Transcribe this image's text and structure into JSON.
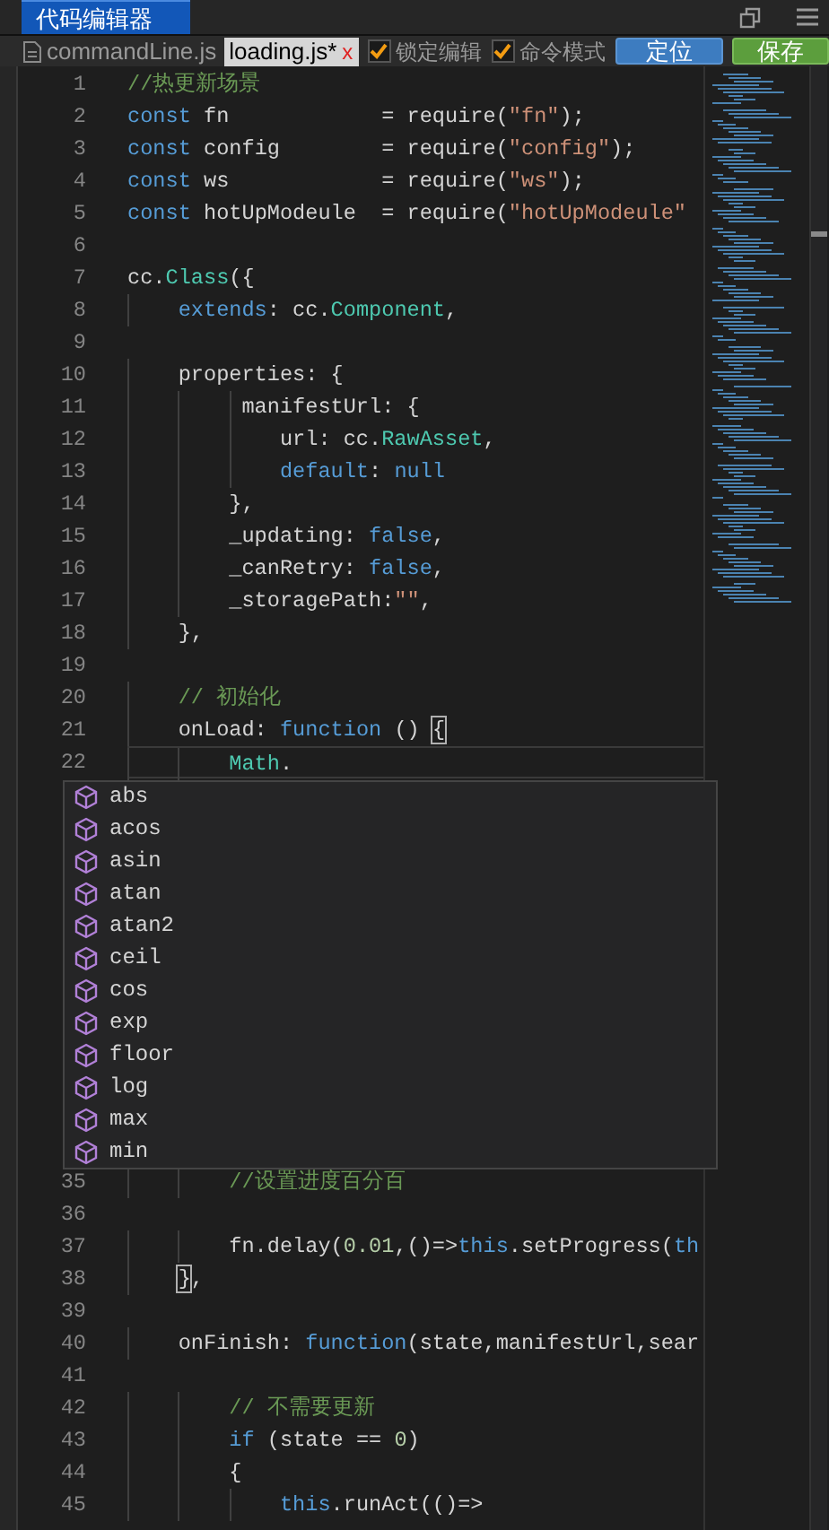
{
  "window": {
    "title": "代码编辑器"
  },
  "toolbar": {
    "tabs": [
      {
        "label": "commandLine.js",
        "selected": false
      },
      {
        "label": "loading.js*",
        "selected": true,
        "close": "x"
      }
    ],
    "checkboxes": [
      {
        "label": "锁定编辑",
        "checked": true
      },
      {
        "label": "命令模式",
        "checked": true
      }
    ],
    "buttons": [
      {
        "label": "定位",
        "kind": "primary"
      },
      {
        "label": "保存",
        "kind": "success"
      }
    ]
  },
  "editor": {
    "lines": [
      {
        "number": "1",
        "tokens": [
          {
            "kind": "com",
            "text": "//热更新场景"
          }
        ]
      },
      {
        "number": "2",
        "tokens": [
          {
            "kind": "kw",
            "text": "const"
          },
          {
            "kind": "id",
            "text": " fn            = require("
          },
          {
            "kind": "str",
            "text": "\"fn\""
          },
          {
            "kind": "id",
            "text": ");"
          }
        ]
      },
      {
        "number": "3",
        "tokens": [
          {
            "kind": "kw",
            "text": "const"
          },
          {
            "kind": "id",
            "text": " config        = require("
          },
          {
            "kind": "str",
            "text": "\"config\""
          },
          {
            "kind": "id",
            "text": ");"
          }
        ]
      },
      {
        "number": "4",
        "tokens": [
          {
            "kind": "kw",
            "text": "const"
          },
          {
            "kind": "id",
            "text": " ws            = require("
          },
          {
            "kind": "str",
            "text": "\"ws\""
          },
          {
            "kind": "id",
            "text": ");"
          }
        ]
      },
      {
        "number": "5",
        "tokens": [
          {
            "kind": "kw",
            "text": "const"
          },
          {
            "kind": "id",
            "text": " hotUpModeule  = require("
          },
          {
            "kind": "str",
            "text": "\"hotUpModeule\""
          }
        ]
      },
      {
        "number": "6"
      },
      {
        "number": "7",
        "tokens": [
          {
            "kind": "id",
            "text": "cc."
          },
          {
            "kind": "type",
            "text": "Class"
          },
          {
            "kind": "id",
            "text": "({"
          }
        ]
      },
      {
        "number": "8",
        "tokens": [
          {
            "kind": "kw",
            "text": "    extends"
          },
          {
            "kind": "id",
            "text": ": cc."
          },
          {
            "kind": "type",
            "text": "Component"
          },
          {
            "kind": "id",
            "text": ","
          }
        ]
      },
      {
        "number": "9"
      },
      {
        "number": "10",
        "tokens": [
          {
            "kind": "id",
            "text": "    properties: {"
          }
        ]
      },
      {
        "number": "11",
        "tokens": [
          {
            "kind": "id",
            "text": "         manifestUrl: {"
          }
        ]
      },
      {
        "number": "12",
        "tokens": [
          {
            "kind": "id",
            "text": "            url: cc."
          },
          {
            "kind": "type",
            "text": "RawAsset"
          },
          {
            "kind": "id",
            "text": ","
          }
        ]
      },
      {
        "number": "13",
        "tokens": [
          {
            "kind": "kw",
            "text": "            default"
          },
          {
            "kind": "id",
            "text": ": "
          },
          {
            "kind": "kw",
            "text": "null"
          }
        ]
      },
      {
        "number": "14",
        "tokens": [
          {
            "kind": "id",
            "text": "        },"
          }
        ]
      },
      {
        "number": "15",
        "tokens": [
          {
            "kind": "id",
            "text": "        _updating: "
          },
          {
            "kind": "kw",
            "text": "false"
          },
          {
            "kind": "id",
            "text": ","
          }
        ]
      },
      {
        "number": "16",
        "tokens": [
          {
            "kind": "id",
            "text": "        _canRetry: "
          },
          {
            "kind": "kw",
            "text": "false"
          },
          {
            "kind": "id",
            "text": ","
          }
        ]
      },
      {
        "number": "17",
        "tokens": [
          {
            "kind": "id",
            "text": "        _storagePath:"
          },
          {
            "kind": "str",
            "text": "\"\""
          },
          {
            "kind": "id",
            "text": ","
          }
        ]
      },
      {
        "number": "18",
        "tokens": [
          {
            "kind": "id",
            "text": "    },"
          }
        ]
      },
      {
        "number": "19"
      },
      {
        "number": "20",
        "tokens": [
          {
            "kind": "com",
            "text": "    // 初始化"
          }
        ]
      },
      {
        "number": "21",
        "tokens": [
          {
            "kind": "id",
            "text": "    onLoad: "
          },
          {
            "kind": "kw",
            "text": "function"
          },
          {
            "kind": "id",
            "text": " () "
          },
          {
            "kind": "bracket",
            "text": "{"
          }
        ]
      },
      {
        "number": "22",
        "current": true,
        "tokens": [
          {
            "kind": "type",
            "text": "        Math"
          },
          {
            "kind": "id",
            "text": "."
          }
        ]
      },
      {
        "number": "35",
        "tokens": [
          {
            "kind": "com",
            "text": "        //设置进度百分百"
          }
        ]
      },
      {
        "number": "36"
      },
      {
        "number": "37",
        "tokens": [
          {
            "kind": "id",
            "text": "        fn.delay("
          },
          {
            "kind": "num",
            "text": "0.01"
          },
          {
            "kind": "id",
            "text": ",()=>"
          },
          {
            "kind": "kw",
            "text": "this"
          },
          {
            "kind": "id",
            "text": ".setProgress("
          },
          {
            "kind": "kw",
            "text": "th"
          }
        ]
      },
      {
        "number": "38",
        "tokens": [
          {
            "kind": "bracket",
            "text": "    }"
          },
          {
            "kind": "id",
            "text": ","
          }
        ]
      },
      {
        "number": "39"
      },
      {
        "number": "40",
        "tokens": [
          {
            "kind": "id",
            "text": "    onFinish: "
          },
          {
            "kind": "kw",
            "text": "function"
          },
          {
            "kind": "id",
            "text": "(state,manifestUrl,sear"
          }
        ]
      },
      {
        "number": "41"
      },
      {
        "number": "42",
        "tokens": [
          {
            "kind": "com",
            "text": "        // 不需要更新"
          }
        ]
      },
      {
        "number": "43",
        "tokens": [
          {
            "kind": "kw",
            "text": "        if"
          },
          {
            "kind": "id",
            "text": " (state == "
          },
          {
            "kind": "num",
            "text": "0"
          },
          {
            "kind": "id",
            "text": ")"
          }
        ]
      },
      {
        "number": "44",
        "tokens": [
          {
            "kind": "id",
            "text": "        {"
          }
        ]
      },
      {
        "number": "45",
        "tokens": [
          {
            "kind": "kw",
            "text": "            this"
          },
          {
            "kind": "id",
            "text": ".runAct(()=>"
          }
        ]
      }
    ]
  },
  "autocomplete": {
    "items": [
      {
        "label": "abs"
      },
      {
        "label": "acos"
      },
      {
        "label": "asin"
      },
      {
        "label": "atan"
      },
      {
        "label": "atan2"
      },
      {
        "label": "ceil"
      },
      {
        "label": "cos"
      },
      {
        "label": "exp"
      },
      {
        "label": "floor"
      },
      {
        "label": "log"
      },
      {
        "label": "max"
      },
      {
        "label": "min"
      }
    ]
  }
}
